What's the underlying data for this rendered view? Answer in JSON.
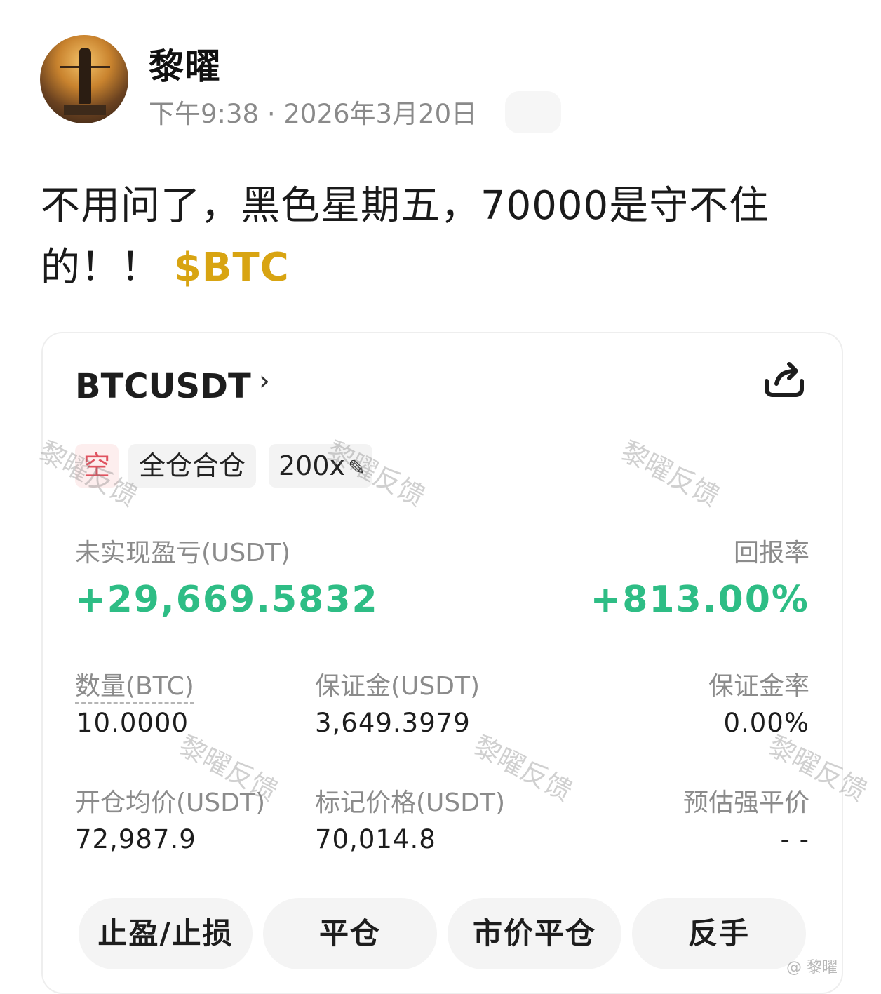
{
  "post": {
    "username": "黎曜",
    "time": "下午9:38 · 2026年3月20日",
    "text": "不用问了，黑色星期五，70000是守不住的！！",
    "ticker_tag": "$BTC"
  },
  "card": {
    "symbol": "BTCUSDT",
    "symbol_chevron": "›",
    "tags": {
      "side": "空",
      "margin_mode": "全仓合仓",
      "leverage": "200x"
    },
    "pnl_label": "未实现盈亏(USDT)",
    "pnl_value": "+29,669.5832",
    "roi_label": "回报率",
    "roi_value": "+813.00%",
    "fields": {
      "qty_label": "数量(BTC)",
      "qty_value": "10.0000",
      "margin_label": "保证金(USDT)",
      "margin_value": "3,649.3979",
      "margin_ratio_label": "保证金率",
      "margin_ratio_value": "0.00%",
      "entry_label": "开仓均价(USDT)",
      "entry_value": "72,987.9",
      "mark_label": "标记价格(USDT)",
      "mark_value": "70,014.8",
      "liq_label": "预估强平价",
      "liq_value": "- -"
    },
    "buttons": {
      "tpsl": "止盈/止损",
      "close": "平仓",
      "market_close": "市价平仓",
      "reverse": "反手"
    },
    "watermark": "黎曜反馈"
  },
  "footer": {
    "credit": "@ 黎曜"
  },
  "colors": {
    "positive": "#2ebd85",
    "short_tag": "#e0525f",
    "ticker": "#d8a412"
  },
  "icons": {
    "share": "share-icon",
    "edit": "pencil-icon",
    "chevron": "chevron-right-icon"
  }
}
